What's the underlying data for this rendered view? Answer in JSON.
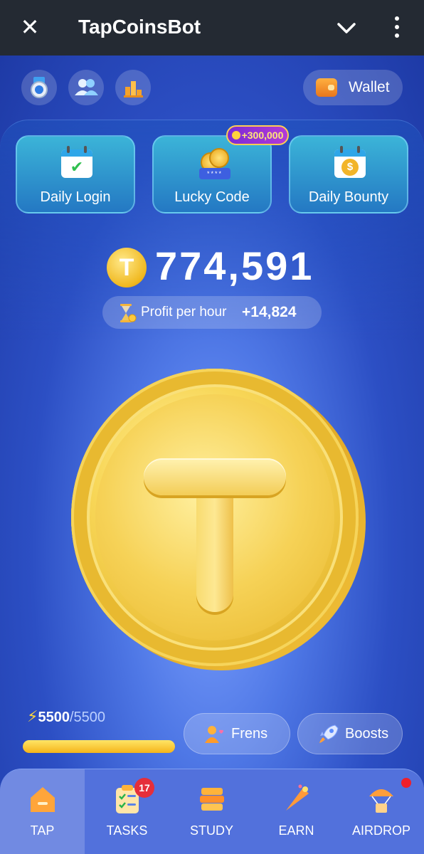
{
  "header": {
    "title": "TapCoinsBot",
    "close_icon": "close-icon",
    "dropdown_icon": "chevron-down-icon",
    "menu_icon": "more-vertical-icon"
  },
  "top_actions": {
    "wallet_label": "Wallet",
    "icons": [
      "medal-icon",
      "friends-icon",
      "leaderboard-icon"
    ]
  },
  "cards": [
    {
      "label": "Daily Login",
      "icon": "calendar-check-icon"
    },
    {
      "label": "Lucky Code",
      "icon": "coins-code-icon",
      "badge": "+300,000"
    },
    {
      "label": "Daily Bounty",
      "icon": "calendar-coin-icon"
    }
  ],
  "balance": {
    "coin_symbol": "T",
    "value": "774,591"
  },
  "profit": {
    "label": "Profit per hour",
    "value": "+14,824"
  },
  "energy": {
    "current": "5500",
    "max": "/5500",
    "fraction": 1.0
  },
  "actions": {
    "frens_label": "Frens",
    "boosts_label": "Boosts"
  },
  "nav": {
    "items": [
      {
        "label": "TAP",
        "icon": "home-icon",
        "active": true
      },
      {
        "label": "TASKS",
        "icon": "tasks-icon",
        "badge": "17"
      },
      {
        "label": "STUDY",
        "icon": "study-icon"
      },
      {
        "label": "EARN",
        "icon": "earn-icon"
      },
      {
        "label": "AIRDROP",
        "icon": "airdrop-icon",
        "dot": true
      }
    ]
  },
  "colors": {
    "header_bg": "#242a33",
    "accent_gold": "#f3c23a",
    "badge_red": "#e52e3a"
  }
}
